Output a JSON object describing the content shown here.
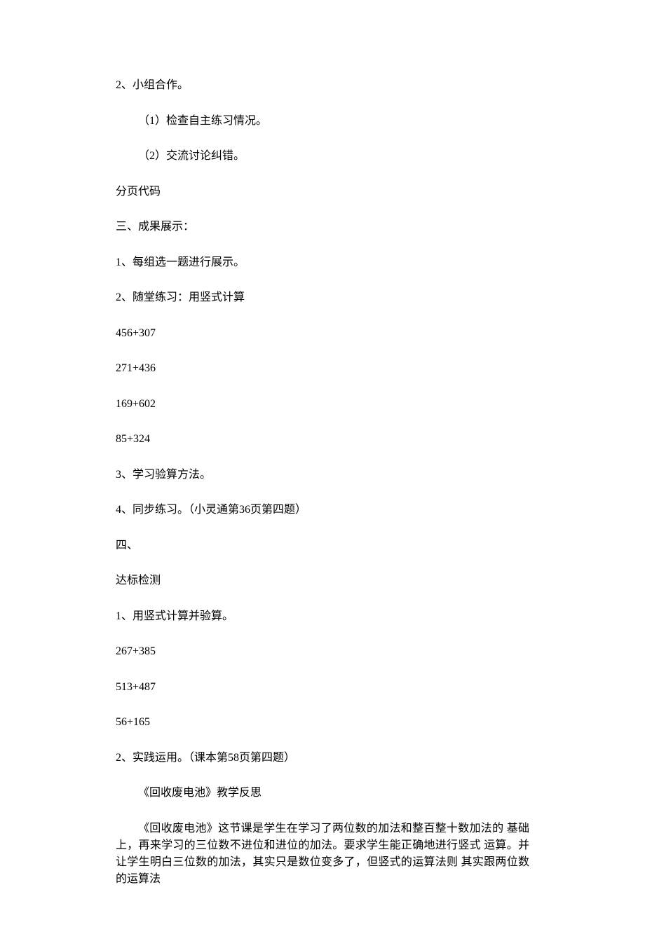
{
  "lines": {
    "l1": "2、小组合作。",
    "l2": "（1）检查自主练习情况。",
    "l3": "（2）交流讨论纠错。",
    "l4": "分页代码",
    "l5": "三、成果展示：",
    "l6": "1、每组选一题进行展示。",
    "l7": "2、随堂练习：用竖式计算",
    "l8": "456+307",
    "l9": "271+436",
    "l10": "169+602",
    "l11": "85+324",
    "l12": "3、学习验算方法。",
    "l13": "4、同步练习。（小灵通第36页第四题）",
    "l14": "四、",
    "l15": "达标检测",
    "l16": "1、用竖式计算并验算。",
    "l17": "267+385",
    "l18": "513+487",
    "l19": "56+165",
    "l20": "2、实践运用。（课本第58页第四题）",
    "l21": "《回收废电池》教学反思",
    "l22": "《回收废电池》这节课是学生在学习了两位数的加法和整百整十数加法的  基础上，再来学习的三位数不进位和进位的加法。要求学生能正确地进行竖式  运算。并让学生明白三位数的加法，其实只是数位变多了，但竖式的运算法则  其实跟两位数的运算法"
  }
}
